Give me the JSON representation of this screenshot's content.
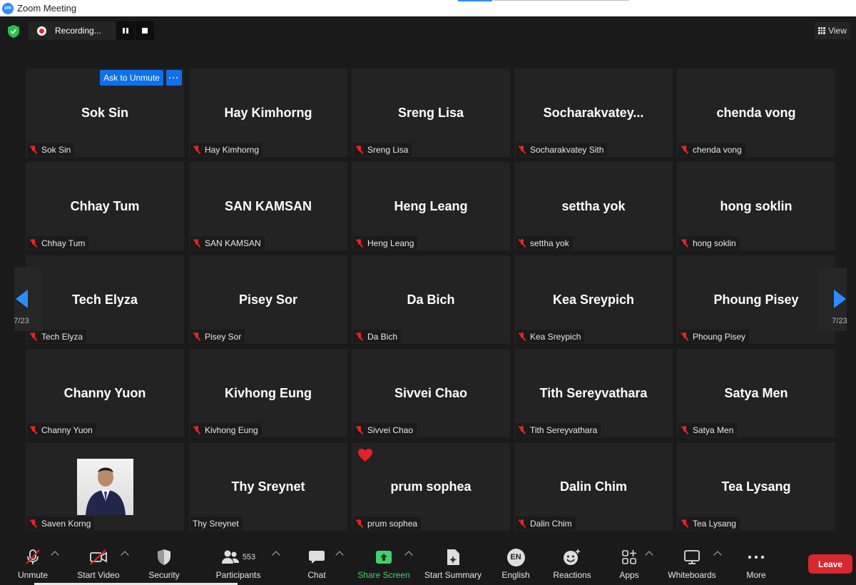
{
  "window": {
    "title": "Zoom Meeting",
    "logo": "zm"
  },
  "topbar": {
    "recording_label": "Recording...",
    "view_label": "View"
  },
  "gallery": {
    "page_left": "7/23",
    "page_right": "7/23",
    "ask_to_unmute": "Ask to Unmute",
    "more_label": "···",
    "tiles": [
      {
        "big": "Sok Sin",
        "tag": "Sok Sin",
        "muted": true
      },
      {
        "big": "Hay Kimhorng",
        "tag": "Hay Kimhorng",
        "muted": true
      },
      {
        "big": "Sreng Lisa",
        "tag": "Sreng Lisa",
        "muted": true
      },
      {
        "big": "Socharakvatey...",
        "tag": "Socharakvatey Sith",
        "muted": true
      },
      {
        "big": "chenda vong",
        "tag": "chenda vong",
        "muted": true
      },
      {
        "big": "Chhay Tum",
        "tag": "Chhay Tum",
        "muted": true
      },
      {
        "big": "SAN KAMSAN",
        "tag": "SAN KAMSAN",
        "muted": true
      },
      {
        "big": "Heng Leang",
        "tag": "Heng Leang",
        "muted": true
      },
      {
        "big": "settha yok",
        "tag": "settha yok",
        "muted": true
      },
      {
        "big": "hong soklin",
        "tag": "hong soklin",
        "muted": true
      },
      {
        "big": "Tech Elyza",
        "tag": "Tech Elyza",
        "muted": true
      },
      {
        "big": "Pisey Sor",
        "tag": "Pisey Sor",
        "muted": true
      },
      {
        "big": "Da Bich",
        "tag": "Da Bich",
        "muted": true
      },
      {
        "big": "Kea Sreypich",
        "tag": "Kea Sreypich",
        "muted": true
      },
      {
        "big": "Phoung Pisey",
        "tag": "Phoung Pisey",
        "muted": true
      },
      {
        "big": "Channy Yuon",
        "tag": "Channy Yuon",
        "muted": true
      },
      {
        "big": "Kivhong Eung",
        "tag": "Kivhong Eung",
        "muted": true
      },
      {
        "big": "Sivvei Chao",
        "tag": "Sivvei Chao",
        "muted": true
      },
      {
        "big": "Tith Sereyvathara",
        "tag": "Tith Sereyvathara",
        "muted": true
      },
      {
        "big": "Satya Men",
        "tag": "Satya Men",
        "muted": true
      },
      {
        "big": "",
        "tag": "Saven Korng",
        "muted": true,
        "photo": true
      },
      {
        "big": "Thy Sreynet",
        "tag": "Thy Sreynet",
        "muted": false
      },
      {
        "big": "prum sophea",
        "tag": "prum sophea",
        "muted": true,
        "reaction": "heart-icon"
      },
      {
        "big": "Dalin Chim",
        "tag": "Dalin Chim",
        "muted": true
      },
      {
        "big": "Tea Lysang",
        "tag": "Tea Lysang",
        "muted": true
      }
    ]
  },
  "toolbar": {
    "unmute": "Unmute",
    "start_video": "Start Video",
    "security": "Security",
    "participants": "Participants",
    "participants_count": "553",
    "chat": "Chat",
    "share_screen": "Share Screen",
    "start_summary": "Start Summary",
    "english": "English",
    "english_badge": "EN",
    "reactions": "Reactions",
    "apps": "Apps",
    "whiteboards": "Whiteboards",
    "more": "More",
    "leave": "Leave"
  },
  "colors": {
    "accent": "#2d8cff",
    "leave": "#d9272e",
    "share": "#3ed36a",
    "muted": "#e22222"
  }
}
